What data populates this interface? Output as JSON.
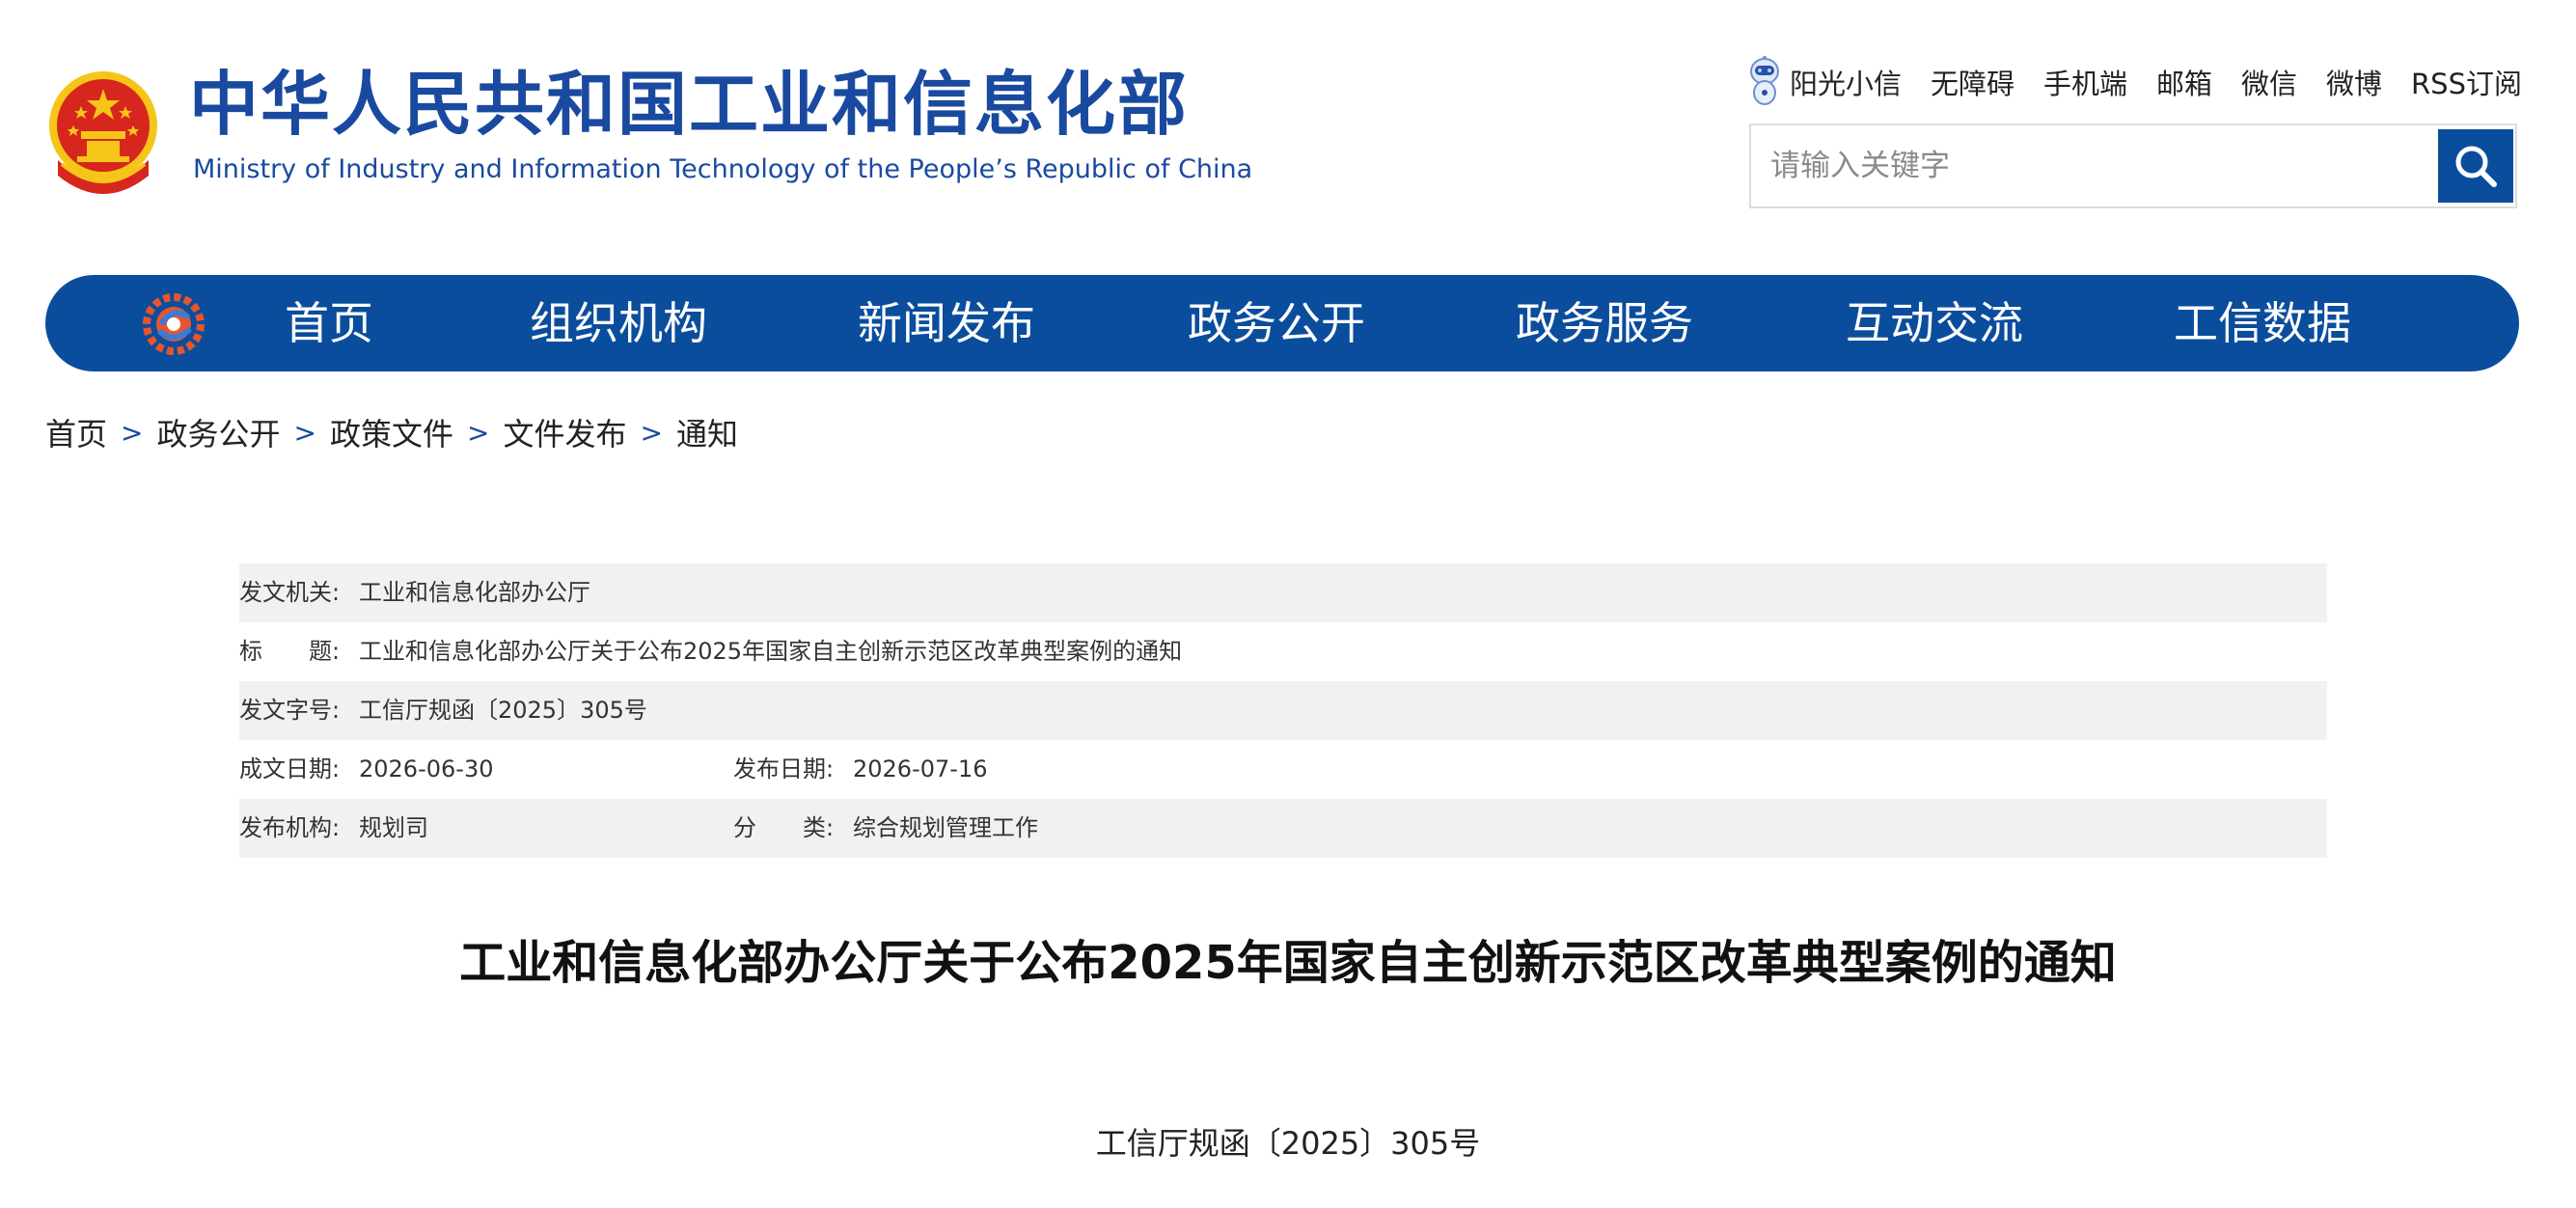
{
  "header": {
    "title_cn": "中华人民共和国工业和信息化部",
    "title_en": "Ministry of Industry and Information Technology of the People’s Republic of China",
    "top_links": [
      "阳光小信",
      "无障碍",
      "手机端",
      "邮箱",
      "微信",
      "微博",
      "RSS订阅"
    ],
    "search": {
      "placeholder": "请输入关键字",
      "value": ""
    },
    "icons": {
      "emblem": "national-emblem-icon",
      "robot": "robot-assistant-icon",
      "search": "search-icon"
    }
  },
  "nav": {
    "logo_icon": "miit-logo-icon",
    "items": [
      "首页",
      "组织机构",
      "新闻发布",
      "政务公开",
      "政务服务",
      "互动交流",
      "工信数据"
    ]
  },
  "breadcrumb": [
    "首页",
    "政务公开",
    "政策文件",
    "文件发布",
    "通知"
  ],
  "meta": {
    "issuer_label": "发文机关:",
    "issuer": "工业和信息化部办公厅",
    "title_label": "标　　题:",
    "title": "工业和信息化部办公厅关于公布2025年国家自主创新示范区改革典型案例的通知",
    "doc_no_label": "发文字号:",
    "doc_no": "工信厅规函〔2025〕305号",
    "written_date_label": "成文日期:",
    "written_date": "2026-06-30",
    "publish_date_label": "发布日期:",
    "publish_date": "2026-07-16",
    "publisher_label": "发布机构:",
    "publisher": "规划司",
    "category_label": "分　　类:",
    "category": "综合规划管理工作"
  },
  "article": {
    "title": "工业和信息化部办公厅关于公布2025年国家自主创新示范区改革典型案例的通知",
    "doc_number": "工信厅规函〔2025〕305号"
  },
  "colors": {
    "brand_blue": "#0b4d9d",
    "title_blue": "#1a4aa0",
    "meta_row_shade": "#f1f1f1"
  }
}
